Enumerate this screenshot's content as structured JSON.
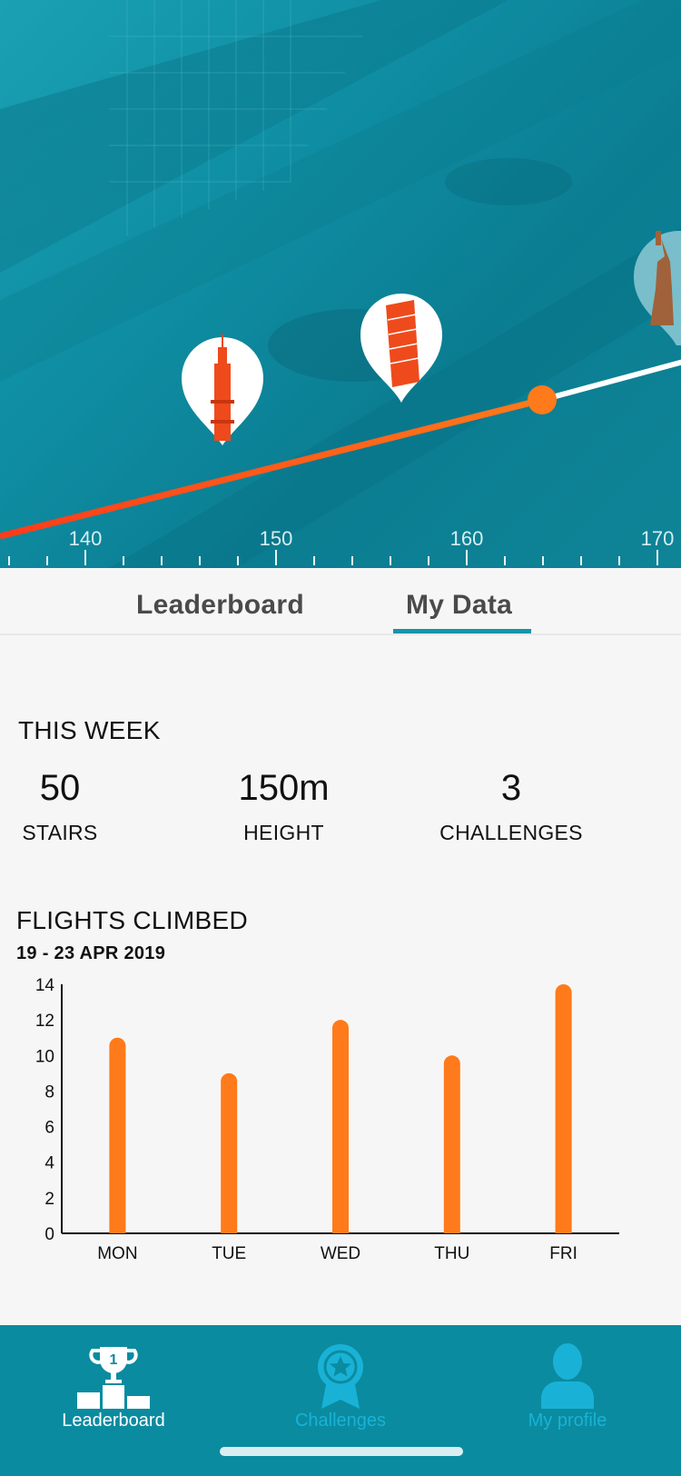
{
  "hero": {
    "scale_ticks": [
      "140",
      "150",
      "160",
      "170"
    ],
    "landmarks": [
      {
        "name": "Dom Tower",
        "icon": "tower-icon"
      },
      {
        "name": "Leaning Tower of Pisa",
        "icon": "pisa-tower-icon"
      },
      {
        "name": "Statue of Liberty",
        "icon": "statue-of-liberty-icon"
      }
    ],
    "progress_value": 164,
    "colors": {
      "progress": "#ff5a1f",
      "remaining": "#ffffff",
      "marker": "#ff7a1a"
    }
  },
  "tabs": [
    {
      "label": "Leaderboard",
      "active": false
    },
    {
      "label": "My Data",
      "active": true
    }
  ],
  "this_week": {
    "title": "THIS WEEK",
    "stats": [
      {
        "value": "50",
        "label": "STAIRS"
      },
      {
        "value": "150m",
        "label": "HEIGHT"
      },
      {
        "value": "3",
        "label": "CHALLENGES"
      }
    ]
  },
  "flights": {
    "title": "FLIGHTS CLIMBED",
    "date_range": "19 - 23 APR 2019"
  },
  "chart_data": {
    "type": "bar",
    "title": "FLIGHTS CLIMBED",
    "subtitle": "19 - 23 APR 2019",
    "categories": [
      "MON",
      "TUE",
      "WED",
      "THU",
      "FRI"
    ],
    "values": [
      11,
      9,
      12,
      10,
      14
    ],
    "y_ticks": [
      "0",
      "2",
      "4",
      "6",
      "8",
      "10",
      "12",
      "14"
    ],
    "ylim": [
      0,
      14
    ],
    "grid": false,
    "bar_color": "#ff7a1a",
    "xlabel": "",
    "ylabel": ""
  },
  "bottom_nav": {
    "items": [
      {
        "label": "Leaderboard",
        "icon": "trophy-podium-icon",
        "active": true
      },
      {
        "label": "Challenges",
        "icon": "award-ribbon-icon",
        "active": false
      },
      {
        "label": "My profile",
        "icon": "person-icon",
        "active": false
      }
    ],
    "active_color": "#ffffff",
    "inactive_color": "#19b2d6"
  }
}
